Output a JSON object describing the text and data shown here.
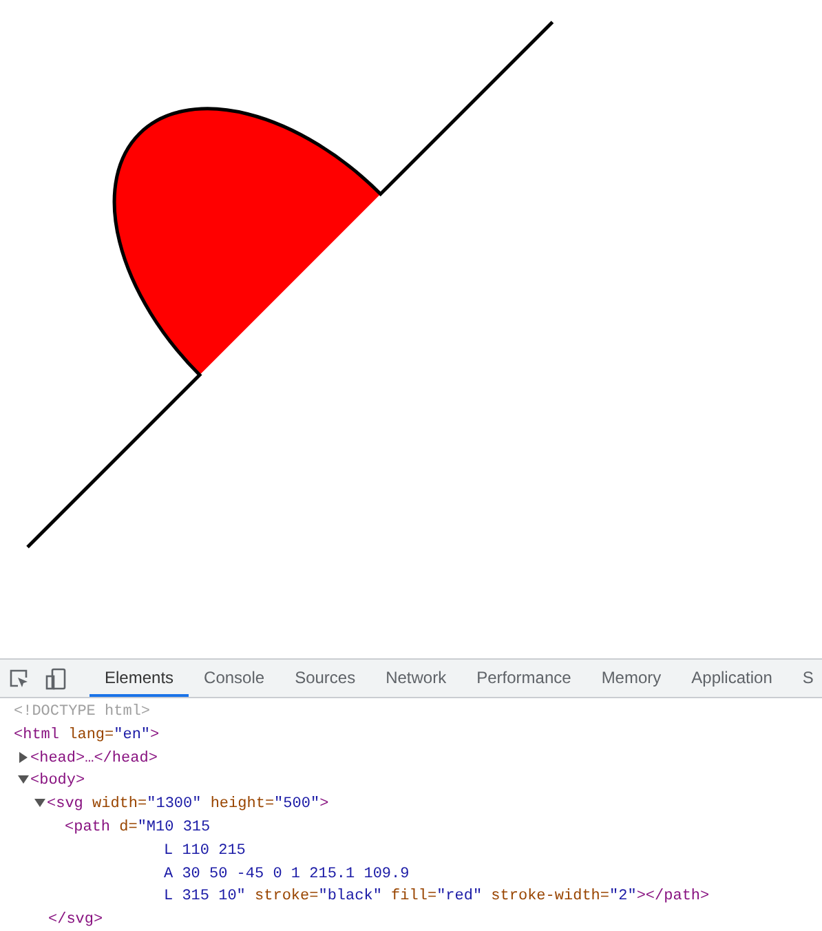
{
  "devtools": {
    "tabs": [
      {
        "label": "Elements",
        "selected": true
      },
      {
        "label": "Console",
        "selected": false
      },
      {
        "label": "Sources",
        "selected": false
      },
      {
        "label": "Network",
        "selected": false
      },
      {
        "label": "Performance",
        "selected": false
      },
      {
        "label": "Memory",
        "selected": false
      },
      {
        "label": "Application",
        "selected": false
      },
      {
        "label": "S",
        "selected": false
      }
    ],
    "dom_tree": [
      {
        "lines": [
          [
            {
              "kind": "doctype",
              "text": "<!DOCTYPE html>"
            }
          ]
        ]
      },
      {
        "lines": [
          [
            {
              "kind": "tag",
              "text": "<html"
            },
            {
              "kind": "attr",
              "text": " lang="
            },
            {
              "kind": "value",
              "text": "\"en\""
            },
            {
              "kind": "tag",
              "text": ">"
            }
          ]
        ],
        "children": [
          {
            "expanded": false,
            "lines": [
              [
                {
                  "kind": "tag",
                  "text": "<head>…</head>"
                }
              ]
            ]
          },
          {
            "expanded": true,
            "lines": [
              [
                {
                  "kind": "tag",
                  "text": "<body>"
                }
              ]
            ],
            "children": [
              {
                "expanded": true,
                "lines": [
                  [
                    {
                      "kind": "tag",
                      "text": "<svg"
                    },
                    {
                      "kind": "attr",
                      "text": " width="
                    },
                    {
                      "kind": "value",
                      "text": "\"1300\""
                    },
                    {
                      "kind": "attr",
                      "text": " height="
                    },
                    {
                      "kind": "value",
                      "text": "\"500\""
                    },
                    {
                      "kind": "tag",
                      "text": ">"
                    }
                  ]
                ],
                "children": [
                  {
                    "lines": [
                      [
                        {
                          "kind": "tag",
                          "text": "<path"
                        },
                        {
                          "kind": "attr",
                          "text": " d="
                        },
                        {
                          "kind": "value",
                          "text": "\"M10 315"
                        }
                      ],
                      [
                        {
                          "kind": "value",
                          "text": "L 110 215"
                        }
                      ],
                      [
                        {
                          "kind": "value",
                          "text": "A 30 50 -45 0 1 215.1 109.9"
                        }
                      ],
                      [
                        {
                          "kind": "value",
                          "text": "L 315 10\""
                        },
                        {
                          "kind": "attr",
                          "text": " stroke="
                        },
                        {
                          "kind": "value",
                          "text": "\"black\""
                        },
                        {
                          "kind": "attr",
                          "text": " fill="
                        },
                        {
                          "kind": "value",
                          "text": "\"red\""
                        },
                        {
                          "kind": "attr",
                          "text": " stroke-width="
                        },
                        {
                          "kind": "value",
                          "text": "\"2\""
                        },
                        {
                          "kind": "tag",
                          "text": "></path>"
                        }
                      ]
                    ]
                  }
                ],
                "closing": [
                  {
                    "kind": "tag",
                    "text": "</svg>"
                  }
                ]
              }
            ]
          }
        ]
      }
    ]
  }
}
